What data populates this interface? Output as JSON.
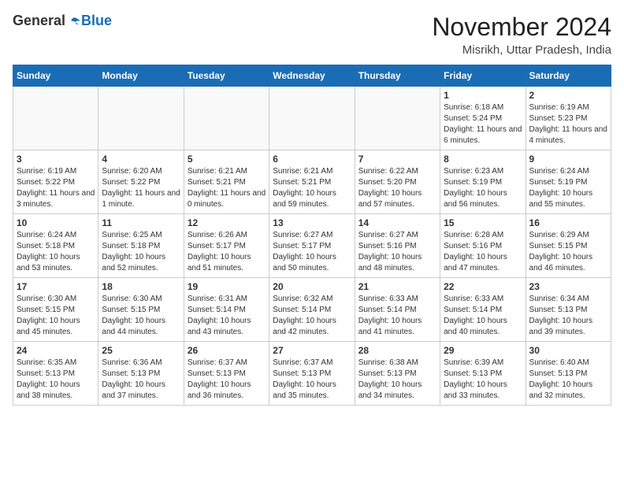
{
  "header": {
    "logo_general": "General",
    "logo_blue": "Blue",
    "month_year": "November 2024",
    "location": "Misrikh, Uttar Pradesh, India"
  },
  "calendar": {
    "days_of_week": [
      "Sunday",
      "Monday",
      "Tuesday",
      "Wednesday",
      "Thursday",
      "Friday",
      "Saturday"
    ],
    "weeks": [
      [
        {
          "day": "",
          "info": ""
        },
        {
          "day": "",
          "info": ""
        },
        {
          "day": "",
          "info": ""
        },
        {
          "day": "",
          "info": ""
        },
        {
          "day": "",
          "info": ""
        },
        {
          "day": "1",
          "info": "Sunrise: 6:18 AM\nSunset: 5:24 PM\nDaylight: 11 hours and 6 minutes."
        },
        {
          "day": "2",
          "info": "Sunrise: 6:19 AM\nSunset: 5:23 PM\nDaylight: 11 hours and 4 minutes."
        }
      ],
      [
        {
          "day": "3",
          "info": "Sunrise: 6:19 AM\nSunset: 5:22 PM\nDaylight: 11 hours and 3 minutes."
        },
        {
          "day": "4",
          "info": "Sunrise: 6:20 AM\nSunset: 5:22 PM\nDaylight: 11 hours and 1 minute."
        },
        {
          "day": "5",
          "info": "Sunrise: 6:21 AM\nSunset: 5:21 PM\nDaylight: 11 hours and 0 minutes."
        },
        {
          "day": "6",
          "info": "Sunrise: 6:21 AM\nSunset: 5:21 PM\nDaylight: 10 hours and 59 minutes."
        },
        {
          "day": "7",
          "info": "Sunrise: 6:22 AM\nSunset: 5:20 PM\nDaylight: 10 hours and 57 minutes."
        },
        {
          "day": "8",
          "info": "Sunrise: 6:23 AM\nSunset: 5:19 PM\nDaylight: 10 hours and 56 minutes."
        },
        {
          "day": "9",
          "info": "Sunrise: 6:24 AM\nSunset: 5:19 PM\nDaylight: 10 hours and 55 minutes."
        }
      ],
      [
        {
          "day": "10",
          "info": "Sunrise: 6:24 AM\nSunset: 5:18 PM\nDaylight: 10 hours and 53 minutes."
        },
        {
          "day": "11",
          "info": "Sunrise: 6:25 AM\nSunset: 5:18 PM\nDaylight: 10 hours and 52 minutes."
        },
        {
          "day": "12",
          "info": "Sunrise: 6:26 AM\nSunset: 5:17 PM\nDaylight: 10 hours and 51 minutes."
        },
        {
          "day": "13",
          "info": "Sunrise: 6:27 AM\nSunset: 5:17 PM\nDaylight: 10 hours and 50 minutes."
        },
        {
          "day": "14",
          "info": "Sunrise: 6:27 AM\nSunset: 5:16 PM\nDaylight: 10 hours and 48 minutes."
        },
        {
          "day": "15",
          "info": "Sunrise: 6:28 AM\nSunset: 5:16 PM\nDaylight: 10 hours and 47 minutes."
        },
        {
          "day": "16",
          "info": "Sunrise: 6:29 AM\nSunset: 5:15 PM\nDaylight: 10 hours and 46 minutes."
        }
      ],
      [
        {
          "day": "17",
          "info": "Sunrise: 6:30 AM\nSunset: 5:15 PM\nDaylight: 10 hours and 45 minutes."
        },
        {
          "day": "18",
          "info": "Sunrise: 6:30 AM\nSunset: 5:15 PM\nDaylight: 10 hours and 44 minutes."
        },
        {
          "day": "19",
          "info": "Sunrise: 6:31 AM\nSunset: 5:14 PM\nDaylight: 10 hours and 43 minutes."
        },
        {
          "day": "20",
          "info": "Sunrise: 6:32 AM\nSunset: 5:14 PM\nDaylight: 10 hours and 42 minutes."
        },
        {
          "day": "21",
          "info": "Sunrise: 6:33 AM\nSunset: 5:14 PM\nDaylight: 10 hours and 41 minutes."
        },
        {
          "day": "22",
          "info": "Sunrise: 6:33 AM\nSunset: 5:14 PM\nDaylight: 10 hours and 40 minutes."
        },
        {
          "day": "23",
          "info": "Sunrise: 6:34 AM\nSunset: 5:13 PM\nDaylight: 10 hours and 39 minutes."
        }
      ],
      [
        {
          "day": "24",
          "info": "Sunrise: 6:35 AM\nSunset: 5:13 PM\nDaylight: 10 hours and 38 minutes."
        },
        {
          "day": "25",
          "info": "Sunrise: 6:36 AM\nSunset: 5:13 PM\nDaylight: 10 hours and 37 minutes."
        },
        {
          "day": "26",
          "info": "Sunrise: 6:37 AM\nSunset: 5:13 PM\nDaylight: 10 hours and 36 minutes."
        },
        {
          "day": "27",
          "info": "Sunrise: 6:37 AM\nSunset: 5:13 PM\nDaylight: 10 hours and 35 minutes."
        },
        {
          "day": "28",
          "info": "Sunrise: 6:38 AM\nSunset: 5:13 PM\nDaylight: 10 hours and 34 minutes."
        },
        {
          "day": "29",
          "info": "Sunrise: 6:39 AM\nSunset: 5:13 PM\nDaylight: 10 hours and 33 minutes."
        },
        {
          "day": "30",
          "info": "Sunrise: 6:40 AM\nSunset: 5:13 PM\nDaylight: 10 hours and 32 minutes."
        }
      ]
    ]
  }
}
